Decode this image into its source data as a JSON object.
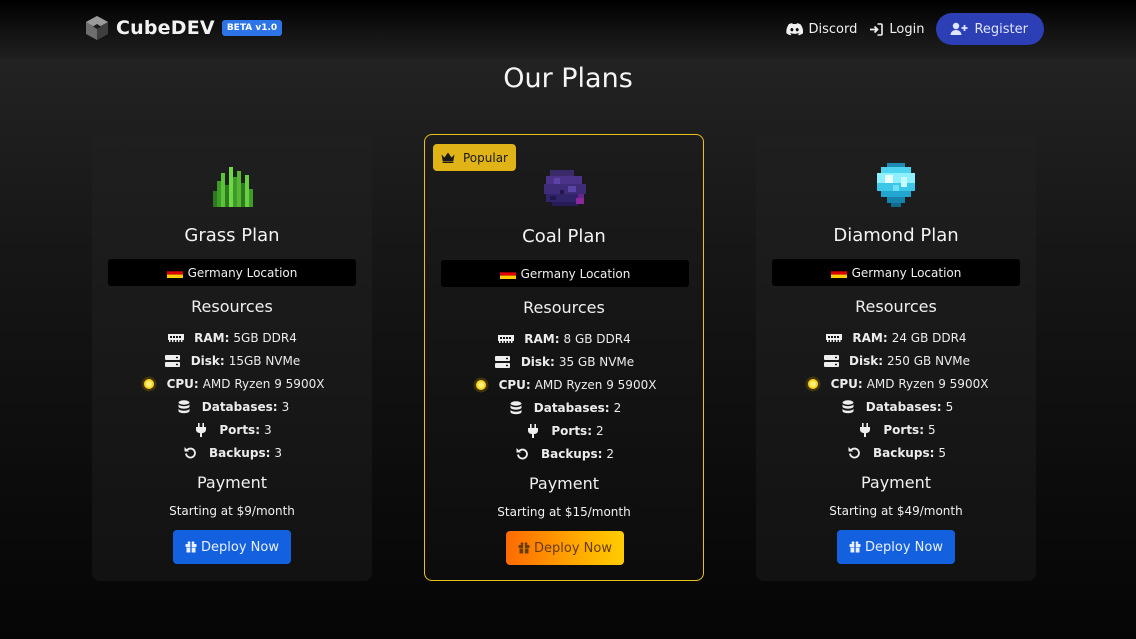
{
  "nav": {
    "brand": "CubeDEV",
    "beta": "BETA v1.0",
    "discord": "Discord",
    "login": "Login",
    "register": "Register"
  },
  "page": {
    "title": "Our Plans"
  },
  "colors": {
    "accent_blue": "#1461e0",
    "featured_border": "#e8c21a",
    "register": "#2c3fb5"
  },
  "plans": [
    {
      "name": "Grass Plan",
      "icon": "grass-icon",
      "location": "Germany Location",
      "resources_title": "Resources",
      "ram_label": "RAM:",
      "ram": "5GB DDR4",
      "disk_label": "Disk:",
      "disk": "15GB NVMe",
      "cpu_label": "CPU:",
      "cpu": "AMD Ryzen 9 5900X",
      "db_label": "Databases:",
      "db": "3",
      "ports_label": "Ports:",
      "ports": "3",
      "backups_label": "Backups:",
      "backups": "3",
      "payment_title": "Payment",
      "price": "Starting at $9/month",
      "button": "Deploy Now"
    },
    {
      "name": "Coal Plan",
      "icon": "coal-icon",
      "badge": "Popular",
      "location": "Germany Location",
      "resources_title": "Resources",
      "ram_label": "RAM:",
      "ram": "8 GB DDR4",
      "disk_label": "Disk:",
      "disk": "35 GB NVMe",
      "cpu_label": "CPU:",
      "cpu": "AMD Ryzen 9 5900X",
      "db_label": "Databases:",
      "db": "2",
      "ports_label": "Ports:",
      "ports": "2",
      "backups_label": "Backups:",
      "backups": "2",
      "payment_title": "Payment",
      "price": "Starting at $15/month",
      "button": "Deploy Now"
    },
    {
      "name": "Diamond Plan",
      "icon": "diamond-icon",
      "location": "Germany Location",
      "resources_title": "Resources",
      "ram_label": "RAM:",
      "ram": "24 GB DDR4",
      "disk_label": "Disk:",
      "disk": "250 GB NVMe",
      "cpu_label": "CPU:",
      "cpu": "AMD Ryzen 9 5900X",
      "db_label": "Databases:",
      "db": "5",
      "ports_label": "Ports:",
      "ports": "5",
      "backups_label": "Backups:",
      "backups": "5",
      "payment_title": "Payment",
      "price": "Starting at $49/month",
      "button": "Deploy Now"
    }
  ]
}
